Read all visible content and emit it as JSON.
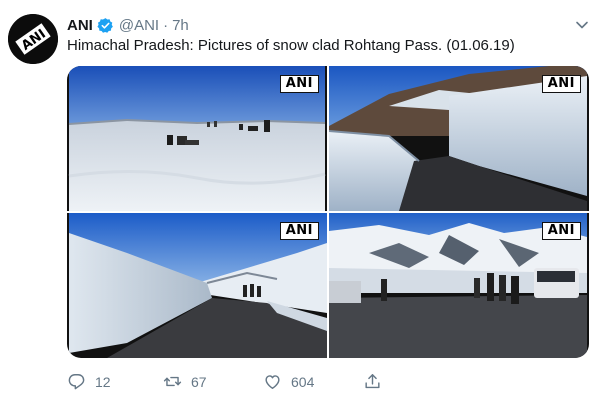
{
  "tweet": {
    "name": "ANI",
    "handle": "@ANI",
    "separator": "·",
    "time": "7h",
    "text": "Himachal Pradesh: Pictures of snow clad Rohtang Pass. (01.06.19)",
    "avatar_text": "ANI",
    "watermark": "ANI",
    "verified_color": "#1da1f2"
  },
  "actions": {
    "reply_count": "12",
    "retweet_count": "67",
    "like_count": "604"
  },
  "icons": [
    "reply-icon",
    "retweet-icon",
    "like-icon",
    "share-icon",
    "verified-badge-icon",
    "chevron-down-icon"
  ]
}
